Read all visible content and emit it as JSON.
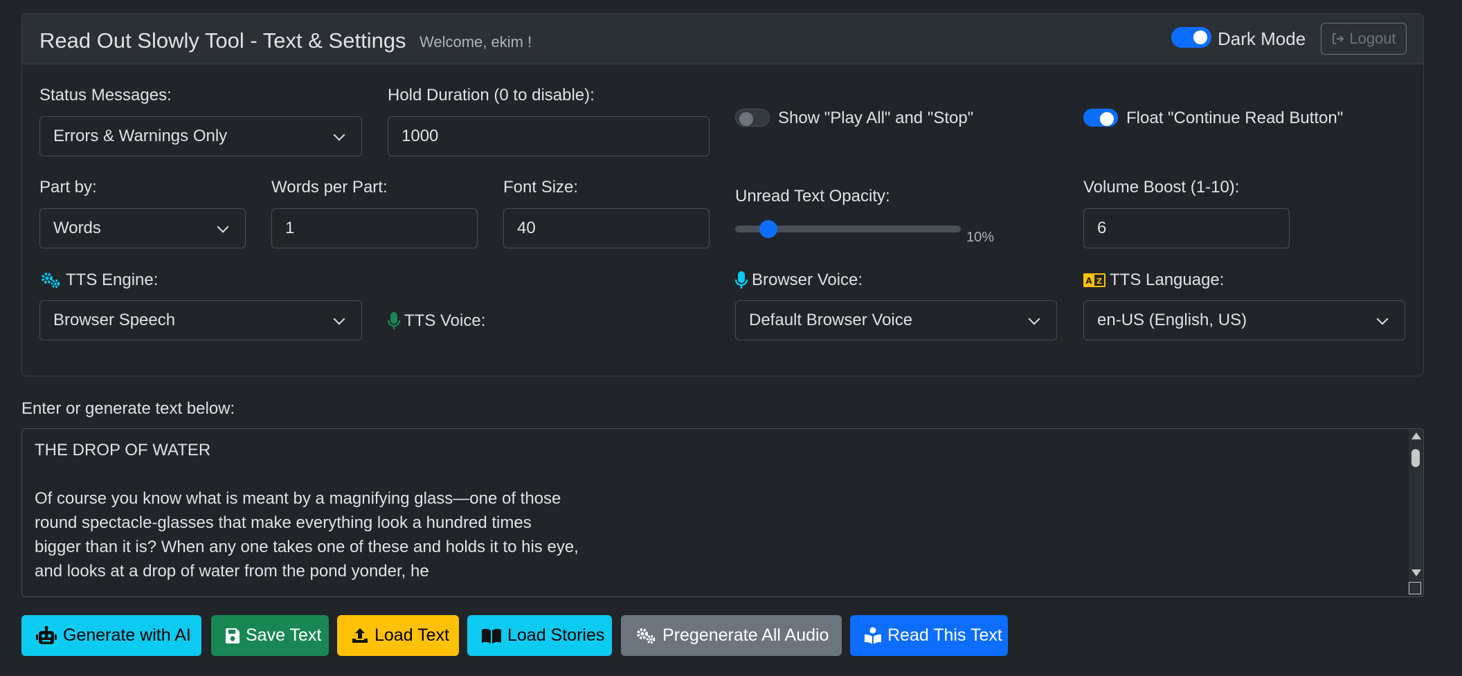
{
  "header": {
    "title": "Read Out Slowly Tool - Text & Settings",
    "welcome": "Welcome, ekim !",
    "dark_mode_label": "Dark Mode",
    "dark_mode_on": true,
    "logout_label": "Logout"
  },
  "settings": {
    "status_messages": {
      "label": "Status Messages:",
      "value": "Errors & Warnings Only"
    },
    "hold_duration": {
      "label": "Hold Duration (0 to disable):",
      "value": "1000"
    },
    "show_play_all": {
      "label": "Show \"Play All\" and \"Stop\"",
      "on": false
    },
    "float_continue": {
      "label": "Float \"Continue Read Button\"",
      "on": true
    },
    "part_by": {
      "label": "Part by:",
      "value": "Words"
    },
    "words_per_part": {
      "label": "Words per Part:",
      "value": "1"
    },
    "font_size": {
      "label": "Font Size:",
      "value": "40"
    },
    "unread_opacity": {
      "label": "Unread Text Opacity:",
      "value_text": "10%",
      "value": 10
    },
    "volume_boost": {
      "label": "Volume Boost (1-10):",
      "value": "6"
    },
    "tts_engine": {
      "label": "TTS Engine:",
      "value": "Browser Speech"
    },
    "tts_voice": {
      "label": "TTS Voice:"
    },
    "browser_voice": {
      "label": "Browser Voice:",
      "value": "Default Browser Voice"
    },
    "tts_language": {
      "label": "TTS Language:",
      "value": "en-US (English, US)"
    }
  },
  "editor": {
    "label": "Enter or generate text below:",
    "text": "THE DROP OF WATER\n\nOf course you know what is meant by a magnifying glass—one of those round spectacle-glasses that make everything look a hundred times bigger than it is? When any one takes one of these and holds it to his eye, and looks at a drop of water from the pond yonder, he"
  },
  "buttons": {
    "generate_ai": "Generate with AI",
    "save_text": "Save Text",
    "load_text": "Load Text",
    "load_stories": "Load Stories",
    "pregenerate": "Pregenerate All Audio",
    "read_text": "Read This Text"
  },
  "colors": {
    "primary": "#0d6efd",
    "info": "#0dcaf0",
    "success": "#198754",
    "warning": "#ffc107",
    "secondary": "#6c757d"
  }
}
